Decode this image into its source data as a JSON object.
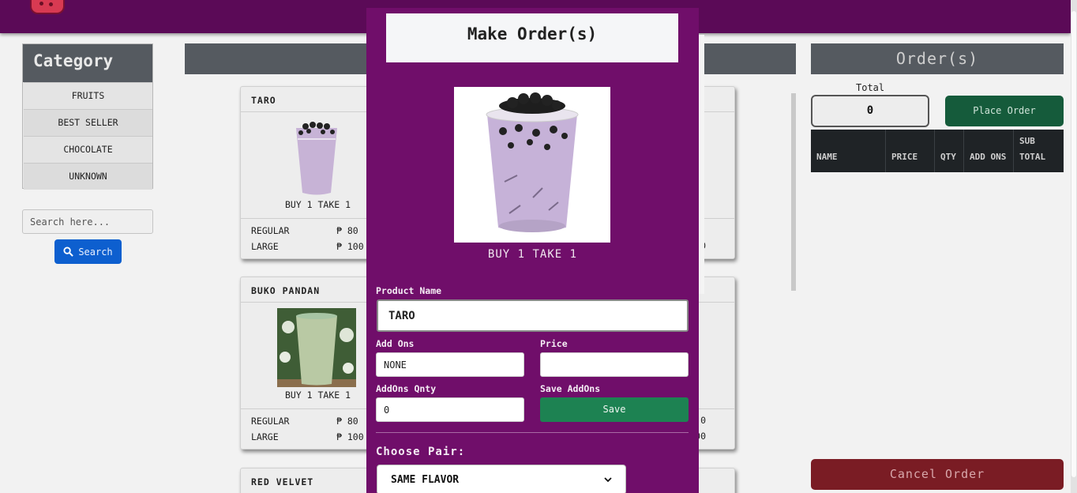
{
  "category": {
    "title": "Category",
    "items": [
      "FRUITS",
      "BEST SELLER",
      "CHOCOLATE",
      "UNKNOWN"
    ],
    "search_placeholder": "Search here...",
    "search_label": "Search"
  },
  "products": [
    {
      "name": "TARO",
      "promo": "BUY 1 TAKE 1",
      "sizes": [
        {
          "label": "REGULAR",
          "price": "₱ 80"
        },
        {
          "label": "LARGE",
          "price": "₱ 100"
        }
      ],
      "right_fragment": "0"
    },
    {
      "name": "BUKO PANDAN",
      "promo": "BUY 1 TAKE 1",
      "sizes": [
        {
          "label": "REGULAR",
          "price": "₱ 80"
        },
        {
          "label": "LARGE",
          "price": "₱ 100"
        }
      ],
      "right_fragment_regular": "0",
      "right_fragment_large": "00"
    },
    {
      "name": "RED VELVET"
    }
  ],
  "orders": {
    "title": "Order(s)",
    "total_label": "Total",
    "total_value": "0",
    "place_order_label": "Place Order",
    "columns": [
      "NAME",
      "PRICE",
      "QTY",
      "ADD ONS",
      "SUB TOTAL"
    ],
    "cancel_label": "Cancel Order"
  },
  "modal": {
    "title": "Make Order(s)",
    "image_label": "BUY 1 TAKE 1",
    "product_name_label": "Product Name",
    "product_name_value": "TARO",
    "addons_label": "Add Ons",
    "addons_value": "NONE",
    "price_label": "Price",
    "price_value": "",
    "addons_qty_label": "AddOns Qnty",
    "addons_qty_value": "0",
    "save_addons_label": "Save AddOns",
    "save_label": "Save",
    "choose_pair_label": "Choose Pair:",
    "pair_value": "SAME FLAVOR"
  },
  "colors": {
    "topbar": "#5b0a57",
    "modal_bg": "#700e6a",
    "save_green": "#1d8252",
    "place_order_green": "#155b3b",
    "cancel_red": "#7a1c24",
    "search_blue": "#0d5fcf"
  }
}
